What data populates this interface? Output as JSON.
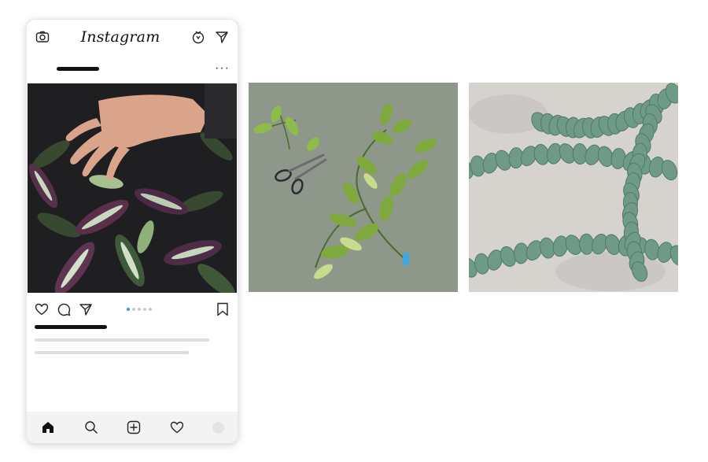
{
  "app": {
    "title": "Instagram"
  },
  "icons": {
    "camera": "camera-icon",
    "igtv": "igtv-icon",
    "direct": "send-icon",
    "more": "more-icon",
    "like": "heart-icon",
    "comment": "comment-icon",
    "share": "send-icon",
    "save": "bookmark-icon",
    "home": "home-icon",
    "search": "search-icon",
    "add": "add-post-icon",
    "activity": "heart-icon",
    "profile": "avatar"
  },
  "post": {
    "more_label": "···",
    "carousel": {
      "count": 5,
      "active": 1
    }
  },
  "colors": {
    "accent": "#3897f0",
    "placeholder": "#dcdcdc",
    "plant_green": "#6e8f4a",
    "purple_leaf": "#5b2f4a",
    "background_sage": "#8d988a",
    "background_stone": "#d6d3cf"
  }
}
